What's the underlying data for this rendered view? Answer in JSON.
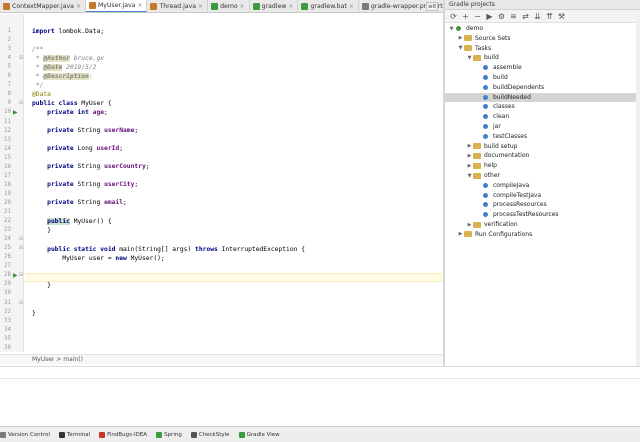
{
  "tabs": [
    {
      "label": "ContextMapper.java",
      "active": false,
      "color": "#c47a2c"
    },
    {
      "label": "MyUser.java",
      "active": true,
      "color": "#c47a2c"
    },
    {
      "label": "Thread.java",
      "active": false,
      "color": "#c47a2c"
    },
    {
      "label": "demo",
      "active": false,
      "color": "#3d9a3d"
    },
    {
      "label": "gradlew",
      "active": false,
      "color": "#3d9a3d"
    },
    {
      "label": "gradlew.bat",
      "active": false,
      "color": "#3d9a3d"
    },
    {
      "label": "gradle-wrapper.properties",
      "active": false,
      "color": "#7a7a7a"
    }
  ],
  "tab_overflow": "≡8",
  "line_numbers": [
    "1",
    "2",
    "3",
    "4",
    "5",
    "6",
    "7",
    "8",
    "9",
    "10",
    "11",
    "12",
    "13",
    "14",
    "15",
    "16",
    "17",
    "18",
    "19",
    "20",
    "21",
    "22",
    "23",
    "24",
    "25",
    "26",
    "27",
    "28",
    "29",
    "30",
    "31",
    "32",
    "33",
    "34",
    "35",
    "36"
  ],
  "code": {
    "import_kw": "import",
    "import_rest": " lombok.Data;",
    "doc_open": "/**",
    "author_star": " * ",
    "author_tag": "@Author",
    "author_val": " bruce.gx",
    "date_star": " * ",
    "date_tag": "@Date",
    "date_val": " 2019/5/2",
    "desc_star": " * ",
    "desc_tag": "@Description",
    "desc_val": ":",
    "doc_close": " */",
    "annotation": "@Data",
    "class_kw": "public class",
    "class_name": " MyUser {",
    "f1_kw": "private int",
    "f1_name": "age",
    "f2_kw": "private",
    "f2_type": " String ",
    "f2_name": "userName",
    "f3_kw": "private",
    "f3_type": " Long ",
    "f3_name": "userId",
    "f4_kw": "private",
    "f4_type": " String ",
    "f4_name": "userCountry",
    "f5_kw": "private",
    "f5_type": " String ",
    "f5_name": "userCity",
    "f6_kw": "private",
    "f6_type": " String ",
    "f6_name": "email",
    "semicolon": ";",
    "ctor_kw": "public",
    "ctor_rest": " MyUser() {",
    "ctor_close": "}",
    "main_kw": "public static void",
    "main_sig": " main(String[] args) ",
    "main_throws": "throws",
    "main_exc": " InterruptedException {",
    "stmt1": "MyUser user = ",
    "stmt1_kw": "new",
    "stmt1_rest": " MyUser();",
    "block_close": "}",
    "class_close": "}"
  },
  "breadcrumb": "MyUser  >  main()",
  "gradle": {
    "header": "Gradle projects",
    "toolbar_icons": [
      "refresh-icon",
      "add-icon",
      "remove-icon",
      "run-icon",
      "execute-task-icon",
      "offline-icon",
      "toggle-icon",
      "collapse-icon",
      "expand-icon",
      "settings-icon"
    ],
    "toolbar_glyphs": [
      "⟳",
      "+",
      "−",
      "▶",
      "⚙",
      "≋",
      "⇄",
      "⇊",
      "⇈",
      "⚒"
    ],
    "tree": [
      {
        "label": "demo",
        "depth": 0,
        "arrow": "▼",
        "icon": "gradle"
      },
      {
        "label": "Source Sets",
        "depth": 1,
        "arrow": "▶",
        "icon": "folder"
      },
      {
        "label": "Tasks",
        "depth": 1,
        "arrow": "▼",
        "icon": "folder"
      },
      {
        "label": "build",
        "depth": 2,
        "arrow": "▼",
        "icon": "folder"
      },
      {
        "label": "assemble",
        "depth": 3,
        "arrow": "",
        "icon": "task"
      },
      {
        "label": "build",
        "depth": 3,
        "arrow": "",
        "icon": "task"
      },
      {
        "label": "buildDependents",
        "depth": 3,
        "arrow": "",
        "icon": "task"
      },
      {
        "label": "buildNeeded",
        "depth": 3,
        "arrow": "",
        "icon": "task",
        "selected": true
      },
      {
        "label": "classes",
        "depth": 3,
        "arrow": "",
        "icon": "task"
      },
      {
        "label": "clean",
        "depth": 3,
        "arrow": "",
        "icon": "task"
      },
      {
        "label": "jar",
        "depth": 3,
        "arrow": "",
        "icon": "task"
      },
      {
        "label": "testClasses",
        "depth": 3,
        "arrow": "",
        "icon": "task"
      },
      {
        "label": "build setup",
        "depth": 2,
        "arrow": "▶",
        "icon": "folder"
      },
      {
        "label": "documentation",
        "depth": 2,
        "arrow": "▶",
        "icon": "folder"
      },
      {
        "label": "help",
        "depth": 2,
        "arrow": "▶",
        "icon": "folder"
      },
      {
        "label": "other",
        "depth": 2,
        "arrow": "▼",
        "icon": "folder"
      },
      {
        "label": "compileJava",
        "depth": 3,
        "arrow": "",
        "icon": "task"
      },
      {
        "label": "compileTestJava",
        "depth": 3,
        "arrow": "",
        "icon": "task"
      },
      {
        "label": "processResources",
        "depth": 3,
        "arrow": "",
        "icon": "task"
      },
      {
        "label": "processTestResources",
        "depth": 3,
        "arrow": "",
        "icon": "task"
      },
      {
        "label": "verification",
        "depth": 2,
        "arrow": "▶",
        "icon": "folder"
      },
      {
        "label": "Run Configurations",
        "depth": 1,
        "arrow": "▶",
        "icon": "folder"
      }
    ]
  },
  "tool_windows": [
    {
      "label": "Version Control",
      "color": "#7a7a7a",
      "name": "version-control"
    },
    {
      "label": "Terminal",
      "color": "#333333",
      "name": "terminal"
    },
    {
      "label": "FindBugs-IDEA",
      "color": "#c0392b",
      "name": "findbugs"
    },
    {
      "label": "Spring",
      "color": "#3d9a3d",
      "name": "spring"
    },
    {
      "label": "CheckStyle",
      "color": "#555555",
      "name": "checkstyle"
    },
    {
      "label": "Gradle View",
      "color": "#3d9a3d",
      "name": "gradle-view"
    }
  ],
  "colors": {
    "accent": "#4a7fd6",
    "selection": "#d4d4d4",
    "current_line": "#fffbe0"
  }
}
